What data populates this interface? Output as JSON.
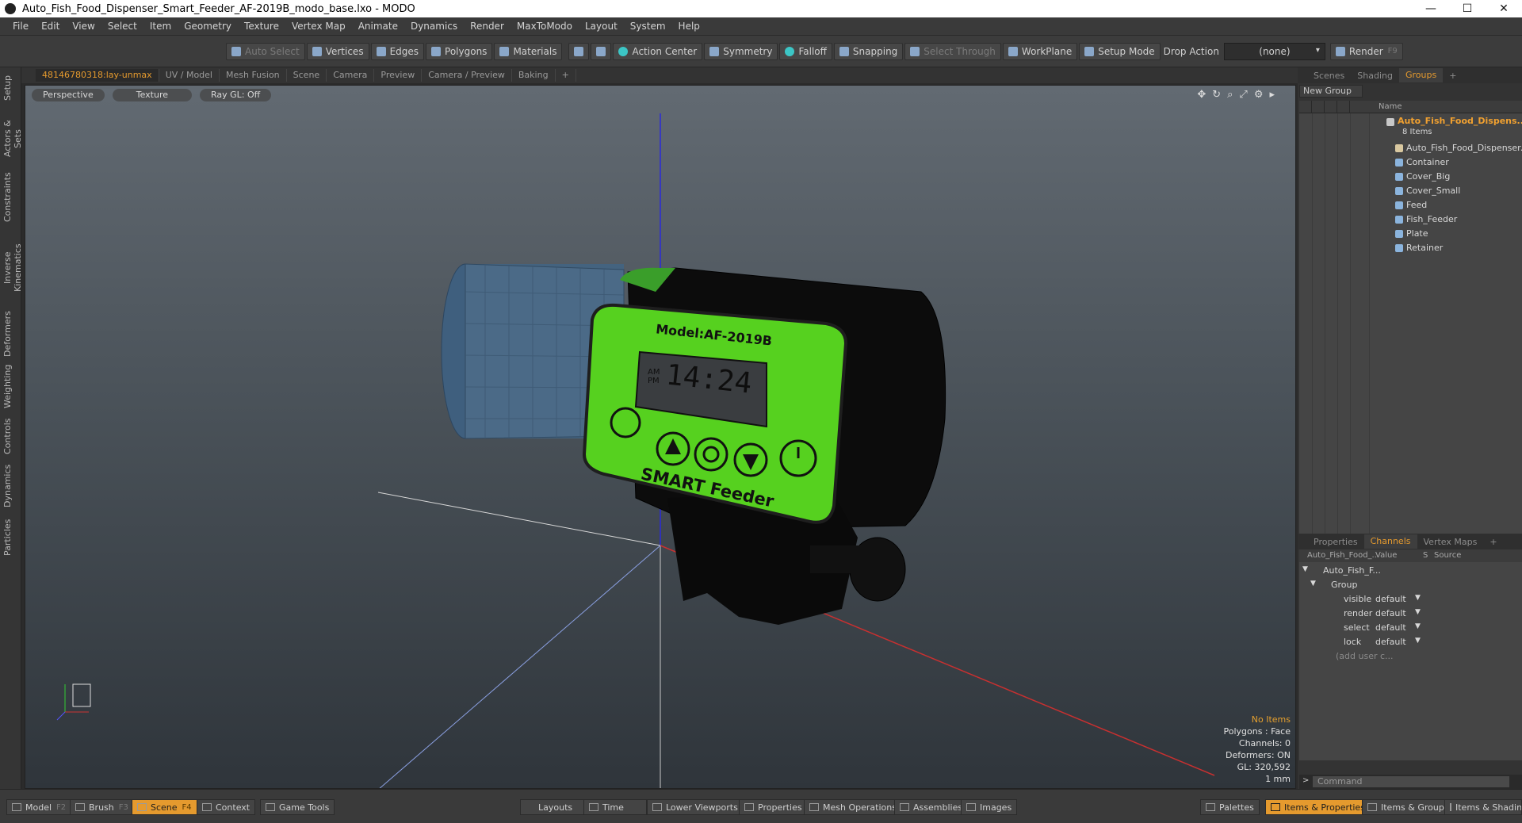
{
  "window": {
    "title": "Auto_Fish_Food_Dispenser_Smart_Feeder_AF-2019B_modo_base.lxo - MODO"
  },
  "menu": [
    "File",
    "Edit",
    "View",
    "Select",
    "Item",
    "Geometry",
    "Texture",
    "Vertex Map",
    "Animate",
    "Dynamics",
    "Render",
    "MaxToModo",
    "Layout",
    "System",
    "Help"
  ],
  "toolbar": {
    "auto_select": "Auto Select",
    "vertices": "Vertices",
    "edges": "Edges",
    "polygons": "Polygons",
    "materials": "Materials",
    "action_center": "Action Center",
    "symmetry": "Symmetry",
    "falloff": "Falloff",
    "snapping": "Snapping",
    "select_through": "Select Through",
    "workplane": "WorkPlane",
    "setup_mode": "Setup Mode",
    "drop_action": "Drop Action",
    "drop_value": "(none)",
    "render": "Render",
    "render_key": "F9"
  },
  "left_tabs": [
    "Setup",
    "Actors & Sets",
    "Constraints",
    "Inverse Kinematics",
    "Deformers",
    "Weighting",
    "Controls",
    "Dynamics",
    "Particles"
  ],
  "viewport_tabs": [
    "48146780318:lay-unmax",
    "UV / Model",
    "Mesh Fusion",
    "Scene",
    "Camera",
    "Preview",
    "Camera / Preview",
    "Baking",
    "+"
  ],
  "viewport": {
    "view": "Perspective",
    "shading": "Texture",
    "raygl": "Ray GL: Off",
    "info": {
      "items": "No Items",
      "polygons": "Polygons : Face",
      "channels": "Channels: 0",
      "deformers": "Deformers: ON",
      "gl": "GL: 320,592",
      "unit": "1 mm"
    },
    "device": {
      "model": "Model:AF-2019B",
      "time": "14:24",
      "ampm": [
        "AM",
        "PM"
      ],
      "brand": "SMART Feeder"
    }
  },
  "groups_panel": {
    "tabs": [
      "Scenes",
      "Shading",
      "Groups",
      "+"
    ],
    "new_group": "New Group",
    "name_header": "Name",
    "root": "Auto_Fish_Food_Dispens...",
    "count": "8 Items",
    "items": [
      "Auto_Fish_Food_Dispenser...",
      "Container",
      "Cover_Big",
      "Cover_Small",
      "Feed",
      "Fish_Feeder",
      "Plate",
      "Retainer"
    ]
  },
  "channels_panel": {
    "tabs": [
      "Properties",
      "Channels",
      "Vertex Maps",
      "+"
    ],
    "headers": {
      "name": "Auto_Fish_Food_...",
      "value": "Value",
      "s": "S",
      "source": "Source"
    },
    "root": "Auto_Fish_F...",
    "group": "Group",
    "rows": [
      {
        "name": "visible",
        "value": "default"
      },
      {
        "name": "render",
        "value": "default"
      },
      {
        "name": "select",
        "value": "default"
      },
      {
        "name": "lock",
        "value": "default"
      }
    ],
    "add_user": "(add user c...",
    "command": "Command"
  },
  "bottom": {
    "model": "Model",
    "model_key": "F2",
    "brush": "Brush",
    "brush_key": "F3",
    "scene": "Scene",
    "scene_key": "F4",
    "context": "Context",
    "game_tools": "Game Tools",
    "layouts": "Layouts",
    "time": "Time",
    "lower_viewports": "Lower Viewports",
    "properties": "Properties",
    "mesh_operations": "Mesh Operations",
    "assemblies": "Assemblies",
    "images": "Images",
    "palettes": "Palettes",
    "items_properties": "Items & Properties",
    "items_groups": "Items & Groups",
    "items_shading": "Items & Shading"
  }
}
